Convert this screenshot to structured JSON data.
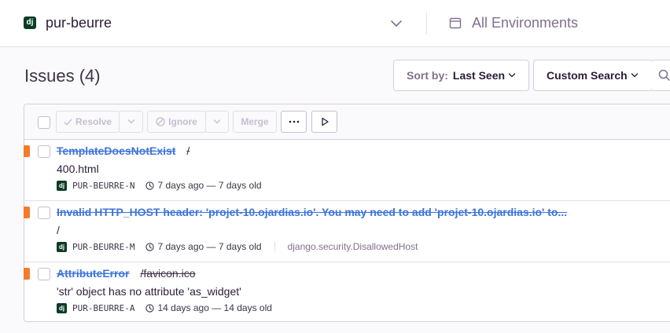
{
  "header": {
    "project_badge": "dj",
    "project_name": "pur-beurre",
    "environment_label": "All Environments"
  },
  "issues_header": {
    "title": "Issues (4)",
    "sort_label": "Sort by:",
    "sort_value": "Last Seen",
    "custom_search": "Custom Search"
  },
  "toolbar": {
    "resolve": "Resolve",
    "ignore": "Ignore",
    "merge": "Merge",
    "more": "···"
  },
  "issues": [
    {
      "title": "TemplateDoesNotExist",
      "culprit": "/",
      "message": "400.html",
      "platform": "dj",
      "short_id": "PUR-BEURRE-N",
      "time": "7 days ago — 7 days old",
      "logger": ""
    },
    {
      "title": "Invalid HTTP_HOST header: 'projet-10.ojardias.io'. You may need to add 'projet-10.ojardias.io' to...",
      "culprit": "",
      "message": "/",
      "platform": "dj",
      "short_id": "PUR-BEURRE-M",
      "time": "7 days ago — 7 days old",
      "logger": "django.security.DisallowedHost"
    },
    {
      "title": "AttributeError",
      "culprit": "/favicon.ico",
      "message": "'str' object has no attribute 'as_widget'",
      "platform": "dj",
      "short_id": "PUR-BEURRE-A",
      "time": "14 days ago — 14 days old",
      "logger": ""
    }
  ],
  "colors": {
    "accent_link": "#3d74db",
    "level_marker": "#f57a2c",
    "django_badge": "#0c3c26"
  }
}
